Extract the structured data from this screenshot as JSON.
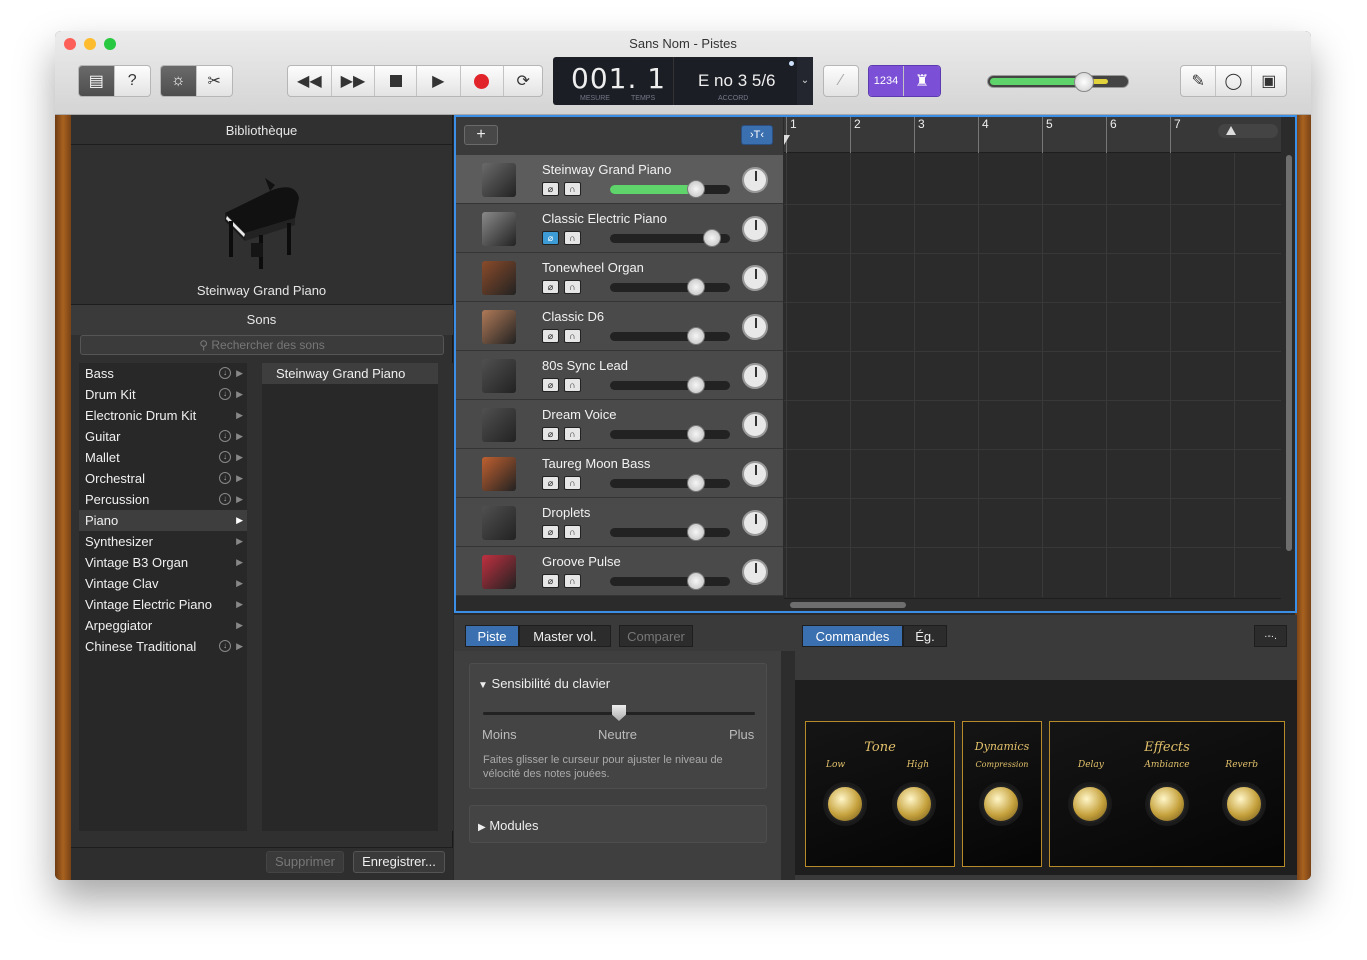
{
  "window": {
    "title": "Sans Nom - Pistes"
  },
  "toolbar": {
    "lcd": {
      "measure": "001. 1",
      "measure_label": "MESURE",
      "beat_label": "TEMPS",
      "chord": "E no 3 5/6",
      "chord_label": "ACCORD"
    },
    "count_in": "1234"
  },
  "library": {
    "title": "Bibliothèque",
    "instrument_name": "Steinway Grand Piano",
    "sounds_title": "Sons",
    "search_placeholder": "Rechercher des sons",
    "categories": [
      {
        "label": "Bass",
        "download": true
      },
      {
        "label": "Drum Kit",
        "download": true
      },
      {
        "label": "Electronic Drum Kit",
        "download": false
      },
      {
        "label": "Guitar",
        "download": true
      },
      {
        "label": "Mallet",
        "download": true
      },
      {
        "label": "Orchestral",
        "download": true
      },
      {
        "label": "Percussion",
        "download": true
      },
      {
        "label": "Piano",
        "download": false,
        "selected": true
      },
      {
        "label": "Synthesizer",
        "download": false
      },
      {
        "label": "Vintage B3 Organ",
        "download": false
      },
      {
        "label": "Vintage Clav",
        "download": false
      },
      {
        "label": "Vintage Electric Piano",
        "download": false
      },
      {
        "label": "Arpeggiator",
        "download": false
      },
      {
        "label": "Chinese Traditional",
        "download": true
      }
    ],
    "patches": [
      "Steinway Grand Piano"
    ],
    "delete_label": "Supprimer",
    "save_label": "Enregistrer..."
  },
  "tracks": [
    {
      "name": "Steinway Grand Piano",
      "volume": 0.72,
      "selected": true,
      "color": "#6a6a6a"
    },
    {
      "name": "Classic Electric Piano",
      "volume": 0.85,
      "color": "#8a8a8a"
    },
    {
      "name": "Tonewheel Organ",
      "volume": 0.72,
      "color": "#8a4b2a"
    },
    {
      "name": "Classic D6",
      "volume": 0.72,
      "color": "#b07a58"
    },
    {
      "name": "80s Sync Lead",
      "volume": 0.72,
      "color": "#505050"
    },
    {
      "name": "Dream Voice",
      "volume": 0.72,
      "color": "#505050"
    },
    {
      "name": "Taureg Moon Bass",
      "volume": 0.72,
      "color": "#c06030"
    },
    {
      "name": "Droplets",
      "volume": 0.72,
      "color": "#505050"
    },
    {
      "name": "Groove Pulse",
      "volume": 0.72,
      "color": "#c03040"
    }
  ],
  "ruler": [
    "1",
    "2",
    "3",
    "4",
    "5",
    "6",
    "7"
  ],
  "bottom": {
    "tabs_left": [
      "Piste",
      "Master vol.",
      "Comparer"
    ],
    "tabs_right": [
      "Commandes",
      "Ég."
    ],
    "sensitivity": {
      "title": "Sensibilité du clavier",
      "less": "Moins",
      "neutral": "Neutre",
      "more": "Plus",
      "value": 0.5,
      "help": "Faites glisser le curseur pour ajuster le niveau de vélocité des notes jouées."
    },
    "modules_label": "Modules",
    "amp": {
      "tone": {
        "title": "Tone",
        "low": "Low",
        "high": "High"
      },
      "dynamics": {
        "title": "Dynamics",
        "compression": "Compression"
      },
      "effects": {
        "title": "Effects",
        "delay": "Delay",
        "ambiance": "Ambiance",
        "reverb": "Reverb"
      }
    }
  },
  "colors": {
    "accent": "#3b8fe6",
    "volume": "#5ed46a",
    "record": "#e0242a",
    "purple": "#7b4fd6"
  }
}
